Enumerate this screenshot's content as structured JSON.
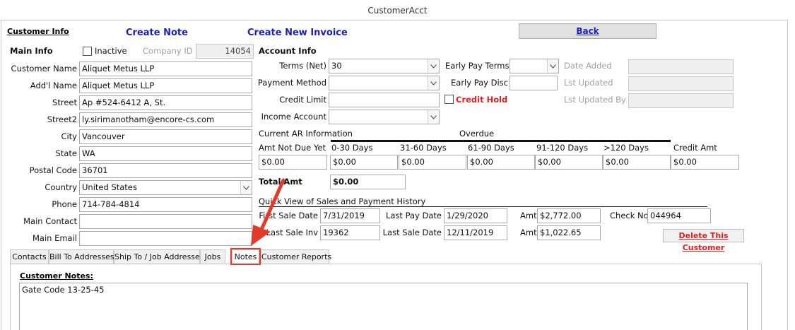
{
  "window": {
    "title": "CustomerAcct"
  },
  "header": {
    "customer_info": "Customer Info",
    "create_note": "Create Note",
    "create_invoice": "Create New Invoice",
    "back": "Back"
  },
  "main_info": {
    "heading": "Main Info",
    "inactive_label": "Inactive",
    "company_id_label": "Company ID",
    "company_id": "14054",
    "fields": {
      "customer_name": {
        "label": "Customer Name",
        "value": "Aliquet Metus LLP"
      },
      "addl_name": {
        "label": "Add'l Name",
        "value": "Aliquet Metus LLP"
      },
      "street": {
        "label": "Street",
        "value": "Ap #524-6412 A, St."
      },
      "street2": {
        "label": "Street2",
        "value": "ly.sirimanotham@encore-cs.com"
      },
      "city": {
        "label": "City",
        "value": "Vancouver"
      },
      "state": {
        "label": "State",
        "value": "WA"
      },
      "postal_code": {
        "label": "Postal Code",
        "value": "36701"
      },
      "country": {
        "label": "Country",
        "value": "United States"
      },
      "phone": {
        "label": "Phone",
        "value": "714-784-4814"
      },
      "main_contact": {
        "label": "Main Contact",
        "value": ""
      },
      "main_email": {
        "label": "Main Email",
        "value": ""
      }
    }
  },
  "account_info": {
    "heading": "Account Info",
    "terms_label": "Terms (Net)",
    "terms_value": "30",
    "payment_method_label": "Payment Method",
    "payment_method_value": "",
    "credit_limit_label": "Credit Limit",
    "credit_limit_value": "",
    "income_account_label": "Income Account",
    "income_account_value": "",
    "early_pay_terms_label": "Early Pay Terms",
    "early_pay_disc_label": "Early Pay Disc",
    "credit_hold_label": "Credit Hold",
    "date_added_label": "Date Added",
    "lst_updated_label": "Lst Updated",
    "lst_updated_by_label": "Lst Updated By"
  },
  "ar": {
    "heading": "Current AR Information",
    "overdue": "Overdue",
    "columns": [
      "Amt Not Due Yet",
      "0-30 Days",
      "31-60 Days",
      "61-90 Days",
      "91-120 Days",
      ">120 Days",
      "Credit Amt"
    ],
    "values": [
      "$0.00",
      "$0.00",
      "$0.00",
      "$0.00",
      "$0.00",
      "$0.00",
      "$0.00"
    ],
    "total_label": "Total Amt",
    "total_value": "$0.00"
  },
  "quick_view": {
    "heading": "Quick View of Sales and Payment History",
    "first_sale_date_label": "First Sale Date",
    "first_sale_date": "7/31/2019",
    "last_pay_date_label": "Last Pay Date",
    "last_pay_date": "1/29/2020",
    "amt_label": "Amt",
    "pay_amt": "$2,772.00",
    "check_no_label": "Check No",
    "check_no": "044964",
    "last_sale_inv_label": "Last Sale Inv",
    "last_sale_inv": "19362",
    "last_sale_date_label": "Last Sale Date",
    "last_sale_date": "12/11/2019",
    "sale_amt": "$1,022.65",
    "delete_customer": "Delete This Customer"
  },
  "tabs": [
    {
      "label": "Contacts"
    },
    {
      "label": "Bill To Addresses"
    },
    {
      "label": "Ship To / Job Addresses"
    },
    {
      "label": "Jobs"
    },
    {
      "label": "Notes"
    },
    {
      "label": "Customer Reports"
    }
  ],
  "notes": {
    "heading": "Customer Notes:",
    "text": "Gate Code 13-25-45"
  },
  "colors": {
    "link_blue": "#1d1dc4",
    "credit_hold_red": "#e02020",
    "annotation_red": "#e23a2b"
  }
}
